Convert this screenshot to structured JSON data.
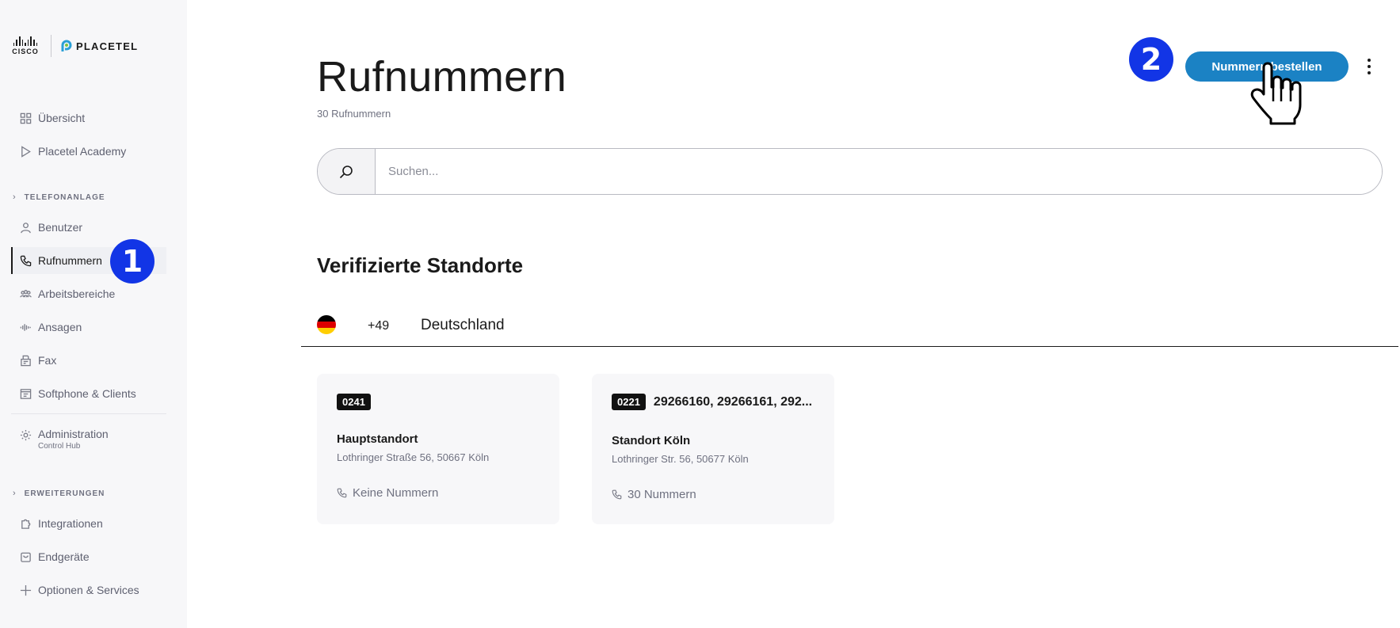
{
  "brand": {
    "cisco": "CISCO",
    "placetel": "PLACETEL"
  },
  "sidebar": {
    "items": [
      {
        "label": "Übersicht",
        "icon": "grid-icon"
      },
      {
        "label": "Placetel Academy",
        "icon": "play-icon"
      },
      {
        "label": "Benutzer",
        "icon": "user-icon"
      },
      {
        "label": "Rufnummern",
        "icon": "phone-icon"
      },
      {
        "label": "Arbeitsbereiche",
        "icon": "team-icon"
      },
      {
        "label": "Ansagen",
        "icon": "soundwave-icon"
      },
      {
        "label": "Fax",
        "icon": "fax-icon"
      },
      {
        "label": "Softphone & Clients",
        "icon": "window-icon"
      },
      {
        "label": "Administration",
        "sublabel": "Control Hub",
        "icon": "gear-icon"
      },
      {
        "label": "Integrationen",
        "icon": "puzzle-icon"
      },
      {
        "label": "Endgeräte",
        "icon": "device-icon"
      },
      {
        "label": "Optionen & Services",
        "icon": "plus-icon"
      }
    ],
    "sections": {
      "telefonanlage": "TELEFONANLAGE",
      "erweiterungen": "ERWEITERUNGEN"
    },
    "active": "Rufnummern"
  },
  "step_badges": {
    "one": "1",
    "two": "2"
  },
  "header": {
    "title": "Rufnummern",
    "count": "30 Rufnummern",
    "order_button": "Nummern bestellen"
  },
  "search": {
    "placeholder": "Suchen..."
  },
  "locations": {
    "title": "Verifizierte Standorte",
    "country": {
      "dial_code": "+49",
      "name": "Deutschland",
      "flag_colors": [
        "#000000",
        "#dd0000",
        "#ffce00"
      ]
    },
    "cards": [
      {
        "area_code": "0241",
        "numbers": "",
        "name": "Hauptstandort",
        "address": "Lothringer Straße 56, 50667 Köln",
        "count": "Keine Nummern"
      },
      {
        "area_code": "0221",
        "numbers": "29266160, 29266161, 292...",
        "name": "Standort Köln",
        "address": "Lothringer Str. 56, 50677 Köln",
        "count": "30 Nummern"
      }
    ]
  },
  "colors": {
    "accent": "#1b82c4",
    "step_badge": "#1235e6",
    "sidebar_bg": "#f7f7f9"
  }
}
